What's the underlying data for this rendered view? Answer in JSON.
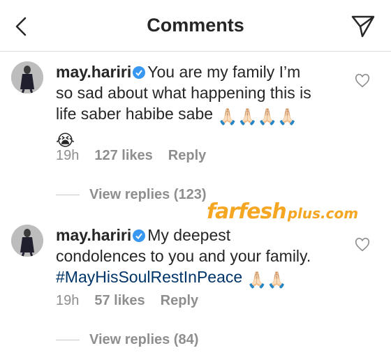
{
  "header": {
    "title": "Comments",
    "back_icon": "chevron-left-icon",
    "send_icon": "paper-plane-icon"
  },
  "comments": [
    {
      "username": "may.hariri",
      "text_line1": "You are my family I’m",
      "text_line2": "so sad about what happening  this is",
      "text_line3": "life saber habibe sabe",
      "emojis": "🙏🏻🙏🏻🙏🏻🙏🏻",
      "emoji_line2": "😭",
      "time": "19h",
      "likes": "127 likes",
      "reply": "Reply",
      "view_replies": "View replies (123)"
    },
    {
      "username": "may.hariri",
      "text_line1": "My deepest",
      "text_line2": "condolences to you and your family.",
      "hashtag": "#MayHisSoulRestInPeace",
      "emojis": "🙏🏻🙏🏻",
      "time": "19h",
      "likes": "57 likes",
      "reply": "Reply",
      "view_replies": "View replies (84)"
    }
  ],
  "watermark": {
    "main": "farfesh",
    "sub": "plus.com"
  },
  "colors": {
    "text": "#262626",
    "secondary": "#8e8e8e",
    "verified": "#3897f0",
    "hashtag": "#003569",
    "watermark": "#f5a623"
  }
}
